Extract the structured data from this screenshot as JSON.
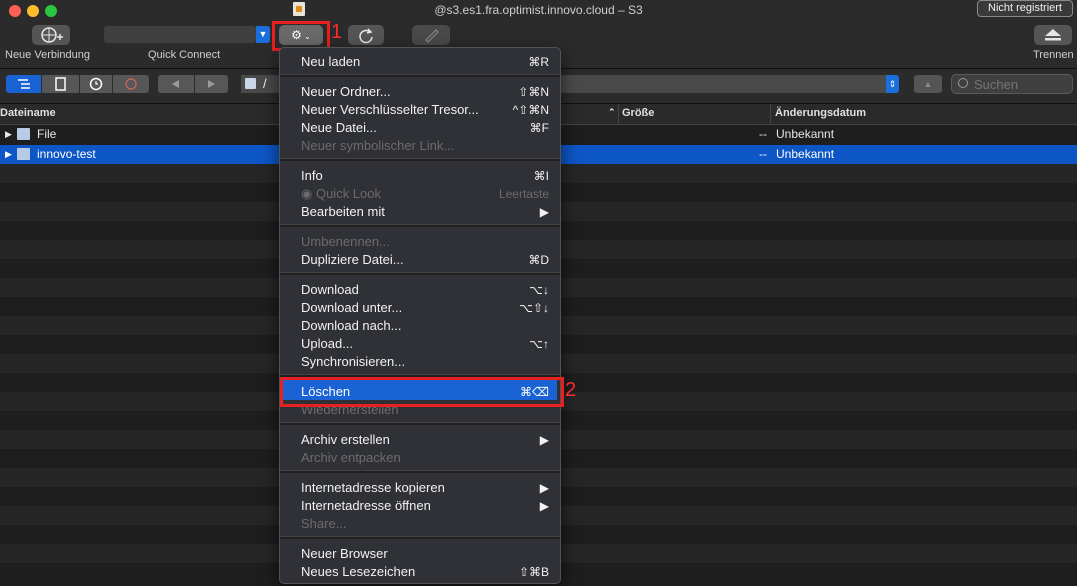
{
  "window": {
    "title": "@s3.es1.fra.optimist.innovo.cloud – S3",
    "not_registered": "Nicht registriert"
  },
  "toolbar": {
    "new_connection_label": "Neue Verbindung",
    "quick_connect_label": "Quick Connect",
    "disconnect_label": "Trennen"
  },
  "annotations": {
    "step1": "1",
    "step2": "2"
  },
  "pathbar": {
    "path": "/",
    "search_placeholder": "Suchen"
  },
  "table": {
    "columns": [
      "Dateiname",
      "Größe",
      "Änderungsdatum"
    ],
    "rows": [
      {
        "name": "File",
        "size": "--",
        "modified": "Unbekannt"
      },
      {
        "name": "innovo-test",
        "size": "--",
        "modified": "Unbekannt"
      }
    ]
  },
  "menu": {
    "items": [
      {
        "label": "Neu laden",
        "shortcut": "⌘R"
      },
      {
        "label": "Neuer Ordner...",
        "shortcut": "⇧⌘N"
      },
      {
        "label": "Neuer Verschlüsselter Tresor...",
        "shortcut": "^⇧⌘N"
      },
      {
        "label": "Neue Datei...",
        "shortcut": "⌘F"
      },
      {
        "label": "Neuer symbolischer Link...",
        "shortcut": ""
      },
      {
        "label": "Info",
        "shortcut": "⌘I"
      },
      {
        "label": "Quick Look",
        "shortcut": "Leertaste"
      },
      {
        "label": "Bearbeiten mit",
        "shortcut": "▶"
      },
      {
        "label": "Umbenennen...",
        "shortcut": ""
      },
      {
        "label": "Dupliziere Datei...",
        "shortcut": "⌘D"
      },
      {
        "label": "Download",
        "shortcut": "⌥↓"
      },
      {
        "label": "Download unter...",
        "shortcut": "⌥⇧↓"
      },
      {
        "label": "Download nach...",
        "shortcut": ""
      },
      {
        "label": "Upload...",
        "shortcut": "⌥↑"
      },
      {
        "label": "Synchronisieren...",
        "shortcut": ""
      },
      {
        "label": "Löschen",
        "shortcut": "⌘⌫"
      },
      {
        "label": "Wiederherstellen",
        "shortcut": ""
      },
      {
        "label": "Archiv erstellen",
        "shortcut": "▶"
      },
      {
        "label": "Archiv entpacken",
        "shortcut": ""
      },
      {
        "label": "Internetadresse kopieren",
        "shortcut": "▶"
      },
      {
        "label": "Internetadresse öffnen",
        "shortcut": "▶"
      },
      {
        "label": "Share...",
        "shortcut": ""
      },
      {
        "label": "Neuer Browser",
        "shortcut": ""
      },
      {
        "label": "Neues Lesezeichen",
        "shortcut": "⇧⌘B"
      }
    ]
  },
  "colors": {
    "accent": "#1a63d4",
    "selection": "#0d56c6",
    "annotation": "#e8201f"
  }
}
